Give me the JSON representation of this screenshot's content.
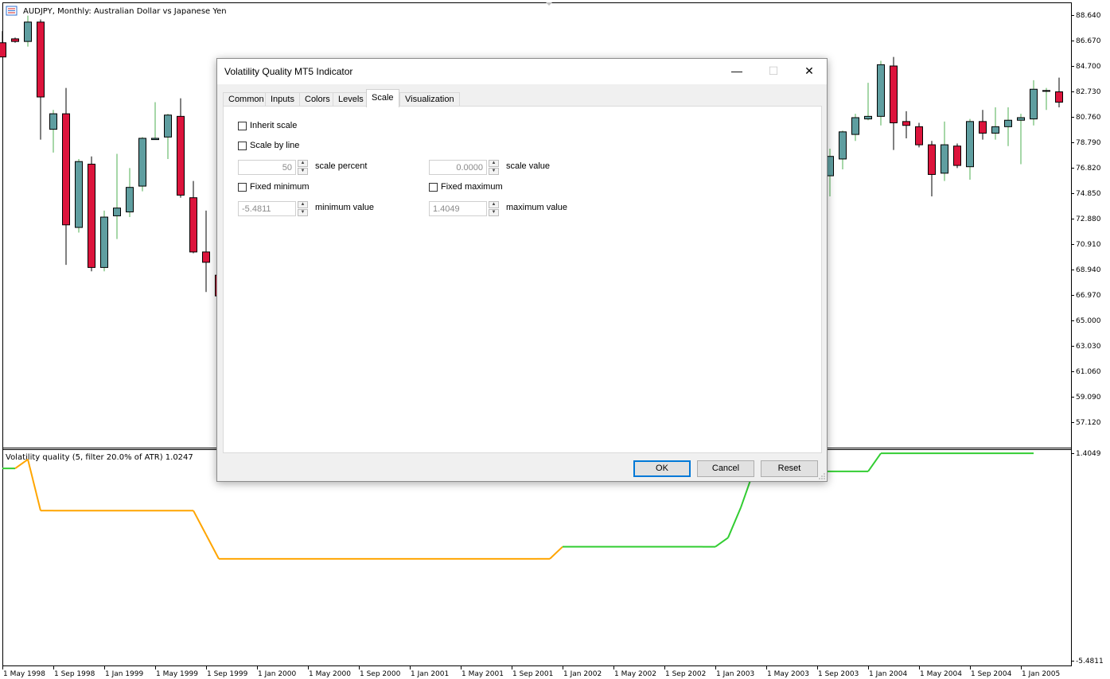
{
  "chart": {
    "main_title": "AUDJPY, Monthly:  Australian Dollar vs Japanese Yen",
    "indicator_label": "Volatility quality (5, filter 20.0% of ATR) 1.0247",
    "price_axis": [
      "88.640",
      "86.670",
      "84.700",
      "82.730",
      "80.760",
      "78.790",
      "76.820",
      "74.850",
      "72.880",
      "70.910",
      "68.940",
      "66.970",
      "65.000",
      "63.030",
      "61.060",
      "59.090",
      "57.120"
    ],
    "indicator_axis": [
      "1.4049",
      "-5.4811"
    ],
    "time_axis": [
      "1 May 1998",
      "1 Sep 1998",
      "1 Jan 1999",
      "1 May 1999",
      "1 Sep 1999",
      "1 Jan 2000",
      "1 May 2000",
      "1 Sep 2000",
      "1 Jan 2001",
      "1 May 2001",
      "1 Sep 2001",
      "1 Jan 2002",
      "1 May 2002",
      "1 Sep 2002",
      "1 Jan 2003",
      "1 May 2003",
      "1 Sep 2003",
      "1 Jan 2004",
      "1 May 2004",
      "1 Sep 2004",
      "1 Jan 2005"
    ],
    "colors": {
      "bull": "#5f9ea0",
      "bear": "#dc143c",
      "line_up": "#32cd32",
      "line_down": "#ffa500"
    },
    "candles_visible_left": [
      {
        "o": 86.5,
        "h": 87.4,
        "l": 85.4,
        "c": 85.4
      },
      {
        "o": 86.8,
        "h": 86.9,
        "l": 86.5,
        "c": 86.6
      },
      {
        "o": 86.6,
        "h": 88.6,
        "l": 86.2,
        "c": 88.1
      },
      {
        "o": 88.1,
        "h": 88.3,
        "l": 79.0,
        "c": 82.3
      },
      {
        "o": 79.8,
        "h": 81.3,
        "l": 78.0,
        "c": 81.0
      },
      {
        "o": 81.0,
        "h": 83.0,
        "l": 69.3,
        "c": 72.4
      },
      {
        "o": 72.2,
        "h": 77.5,
        "l": 71.8,
        "c": 77.3
      },
      {
        "o": 77.1,
        "h": 77.7,
        "l": 68.8,
        "c": 69.1
      },
      {
        "o": 69.1,
        "h": 73.5,
        "l": 68.8,
        "c": 73.0
      },
      {
        "o": 73.1,
        "h": 77.9,
        "l": 71.3,
        "c": 73.7
      },
      {
        "o": 73.4,
        "h": 76.8,
        "l": 73.0,
        "c": 75.3
      },
      {
        "o": 75.4,
        "h": 79.2,
        "l": 75.0,
        "c": 79.1
      },
      {
        "o": 79.0,
        "h": 81.9,
        "l": 79.0,
        "c": 79.1
      },
      {
        "o": 79.2,
        "h": 81.0,
        "l": 77.5,
        "c": 80.9
      },
      {
        "o": 80.8,
        "h": 82.2,
        "l": 74.5,
        "c": 74.7
      },
      {
        "o": 74.5,
        "h": 75.8,
        "l": 70.2,
        "c": 70.3
      },
      {
        "o": 70.3,
        "h": 73.5,
        "l": 67.2,
        "c": 69.5
      },
      {
        "o": 68.5,
        "h": 69.0,
        "l": 66.9,
        "c": 66.9
      }
    ],
    "candles_visible_right": [
      {
        "o": 76.2,
        "h": 78.3,
        "l": 74.6,
        "c": 77.7
      },
      {
        "o": 77.5,
        "h": 79.7,
        "l": 76.7,
        "c": 79.6
      },
      {
        "o": 79.4,
        "h": 81.0,
        "l": 78.9,
        "c": 80.7
      },
      {
        "o": 80.6,
        "h": 83.4,
        "l": 80.5,
        "c": 80.8
      },
      {
        "o": 80.8,
        "h": 85.1,
        "l": 80.1,
        "c": 84.8
      },
      {
        "o": 84.7,
        "h": 85.4,
        "l": 78.2,
        "c": 80.3
      },
      {
        "o": 80.4,
        "h": 81.2,
        "l": 79.1,
        "c": 80.1
      },
      {
        "o": 80.0,
        "h": 80.3,
        "l": 78.4,
        "c": 78.6
      },
      {
        "o": 78.6,
        "h": 78.9,
        "l": 74.6,
        "c": 76.3
      },
      {
        "o": 76.4,
        "h": 80.4,
        "l": 75.8,
        "c": 78.6
      },
      {
        "o": 78.5,
        "h": 78.7,
        "l": 76.8,
        "c": 77.0
      },
      {
        "o": 76.9,
        "h": 80.6,
        "l": 75.9,
        "c": 80.4
      },
      {
        "o": 80.4,
        "h": 81.3,
        "l": 79.0,
        "c": 79.5
      },
      {
        "o": 79.5,
        "h": 81.5,
        "l": 79.0,
        "c": 80.0
      },
      {
        "o": 80.0,
        "h": 81.5,
        "l": 78.5,
        "c": 80.5
      },
      {
        "o": 80.5,
        "h": 81.0,
        "l": 77.1,
        "c": 80.7
      },
      {
        "o": 80.6,
        "h": 83.6,
        "l": 80.1,
        "c": 82.9
      },
      {
        "o": 82.8,
        "h": 83.0,
        "l": 81.3,
        "c": 82.8
      },
      {
        "o": 82.7,
        "h": 83.8,
        "l": 81.5,
        "c": 81.9
      }
    ]
  },
  "chart_data": {
    "type": "line",
    "x": [
      "1 May 1998",
      "1 Jun 1998",
      "1 Jul 1998",
      "1 Aug 1998",
      "1 Sep 1998",
      "1 Aug 1999",
      "1 Sep 1999",
      "1 Oct 1999",
      "1 Nov 2001",
      "1 Dec 2001",
      "1 Jan 2002",
      "1 Dec 2002",
      "1 Jan 2003",
      "1 Feb 2003",
      "1 Mar 2003",
      "1 Apr 2003",
      "1 Jan 2004",
      "1 Feb 2004",
      "1 Feb 2005"
    ],
    "series": [
      {
        "values": [
          0.9,
          0.9,
          1.2,
          -0.5,
          -0.5,
          -0.5,
          -1.3,
          -2.1,
          -2.1,
          -2.1,
          -1.7,
          -1.7,
          -1.7,
          -1.4,
          -0.4,
          0.8,
          0.8,
          1.4,
          1.4
        ]
      }
    ],
    "ylim": [
      -5.4811,
      1.4049
    ]
  },
  "dialog": {
    "title": "Volatility Quality MT5 Indicator",
    "minimize": "—",
    "maximize": "☐",
    "close": "✕",
    "tabs": [
      "Common",
      "Inputs",
      "Colors",
      "Levels",
      "Scale",
      "Visualization"
    ],
    "active_tab": "Scale",
    "inherit_scale": "Inherit scale",
    "scale_by_line": "Scale by line",
    "scale_percent_value": "50",
    "scale_percent_label": "scale percent",
    "scale_value_value": "0.0000",
    "scale_value_label": "scale value",
    "fixed_minimum": "Fixed minimum",
    "fixed_maximum": "Fixed maximum",
    "minimum_value": "-5.4811",
    "minimum_label": "minimum value",
    "maximum_value": "1.4049",
    "maximum_label": "maximum value",
    "spin_up": "▲",
    "spin_down": "▼",
    "ok": "OK",
    "cancel": "Cancel",
    "reset": "Reset"
  }
}
